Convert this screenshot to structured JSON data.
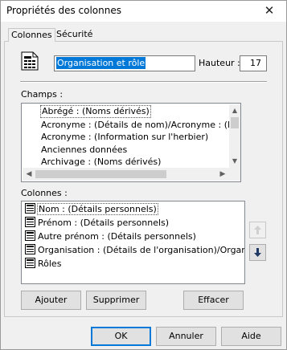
{
  "window": {
    "title": "Propriétés des colonnes",
    "close_glyph": "✕"
  },
  "tabs": [
    {
      "label": "Colonnes",
      "active": true
    },
    {
      "label": "Sécurité",
      "active": false
    }
  ],
  "header": {
    "icon": "document-grid-icon",
    "name_value": "Organisation et rôle",
    "height_label": "Hauteur :",
    "height_value": "17"
  },
  "champs": {
    "label": "Champs :",
    "items": [
      "Abrégé : (Noms dérivés)",
      "Acronyme : (Détails de nom)/Acronyme : (Inform",
      "Acronyme : (Information sur l'herbier)",
      "Anciennes données",
      "Archivage : (Noms dérivés)"
    ],
    "selected_index": 0
  },
  "colonnes": {
    "label": "Colonnes :",
    "items": [
      "Nom : (Détails personnels)",
      "Prénom : (Détails personnels)",
      "Autre prénom : (Détails personnels)",
      "Organisation : (Détails de l'organisation)/Organis...",
      "Rôles"
    ],
    "selected_index": 0,
    "item_icon": "table-column-icon"
  },
  "buttons": {
    "add": "Ajouter",
    "remove": "Supprimer",
    "clear": "Effacer",
    "ok": "OK",
    "cancel": "Annuler",
    "help": "Aide"
  },
  "colors": {
    "selection": "#0078d7",
    "accent_button_border": "#0078d7",
    "move_down_arrow": "#1f3864"
  }
}
